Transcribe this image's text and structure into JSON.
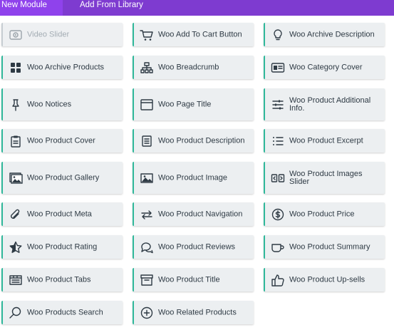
{
  "tabs": {
    "new_module": "New Module",
    "add_from_library": "Add From Library"
  },
  "colors": {
    "tab_bar": "#7e3bd0",
    "tab_active": "#8f42ec",
    "card_accent": "#2fb89a",
    "card_bg": "#eceff1"
  },
  "modules": [
    {
      "label": "Video Slider",
      "icon": "video-slider-icon",
      "disabled": true
    },
    {
      "label": "Woo Add To Cart Button",
      "icon": "cart-icon"
    },
    {
      "label": "Woo Archive Description",
      "icon": "lightbulb-icon"
    },
    {
      "label": "Woo Archive Products",
      "icon": "grid-icon"
    },
    {
      "label": "Woo Breadcrumb",
      "icon": "sitemap-icon"
    },
    {
      "label": "Woo Category Cover",
      "icon": "id-card-icon"
    },
    {
      "label": "Woo Notices",
      "icon": "pin-icon"
    },
    {
      "label": "Woo Page Title",
      "icon": "window-icon"
    },
    {
      "label": "Woo Product Additional Info.",
      "icon": "sliders-icon"
    },
    {
      "label": "Woo Product Cover",
      "icon": "clipboard-icon"
    },
    {
      "label": "Woo Product Description",
      "icon": "document-icon"
    },
    {
      "label": "Woo Product Excerpt",
      "icon": "list-icon"
    },
    {
      "label": "Woo Product Gallery",
      "icon": "gallery-icon"
    },
    {
      "label": "Woo Product Image",
      "icon": "image-icon"
    },
    {
      "label": "Woo Product Images Slider",
      "icon": "images-slider-icon"
    },
    {
      "label": "Woo Product Meta",
      "icon": "paperclip-icon"
    },
    {
      "label": "Woo Product Navigation",
      "icon": "arrows-icon"
    },
    {
      "label": "Woo Product Price",
      "icon": "dollar-icon"
    },
    {
      "label": "Woo Product Rating",
      "icon": "star-icon"
    },
    {
      "label": "Woo Product Reviews",
      "icon": "comments-icon"
    },
    {
      "label": "Woo Product Summary",
      "icon": "mug-icon"
    },
    {
      "label": "Woo Product Tabs",
      "icon": "tabs-icon"
    },
    {
      "label": "Woo Product Title",
      "icon": "archive-box-icon"
    },
    {
      "label": "Woo Product Up-sells",
      "icon": "thumbs-up-icon"
    },
    {
      "label": "Woo Products Search",
      "icon": "search-icon"
    },
    {
      "label": "Woo Related Products",
      "icon": "plus-circle-icon"
    }
  ]
}
